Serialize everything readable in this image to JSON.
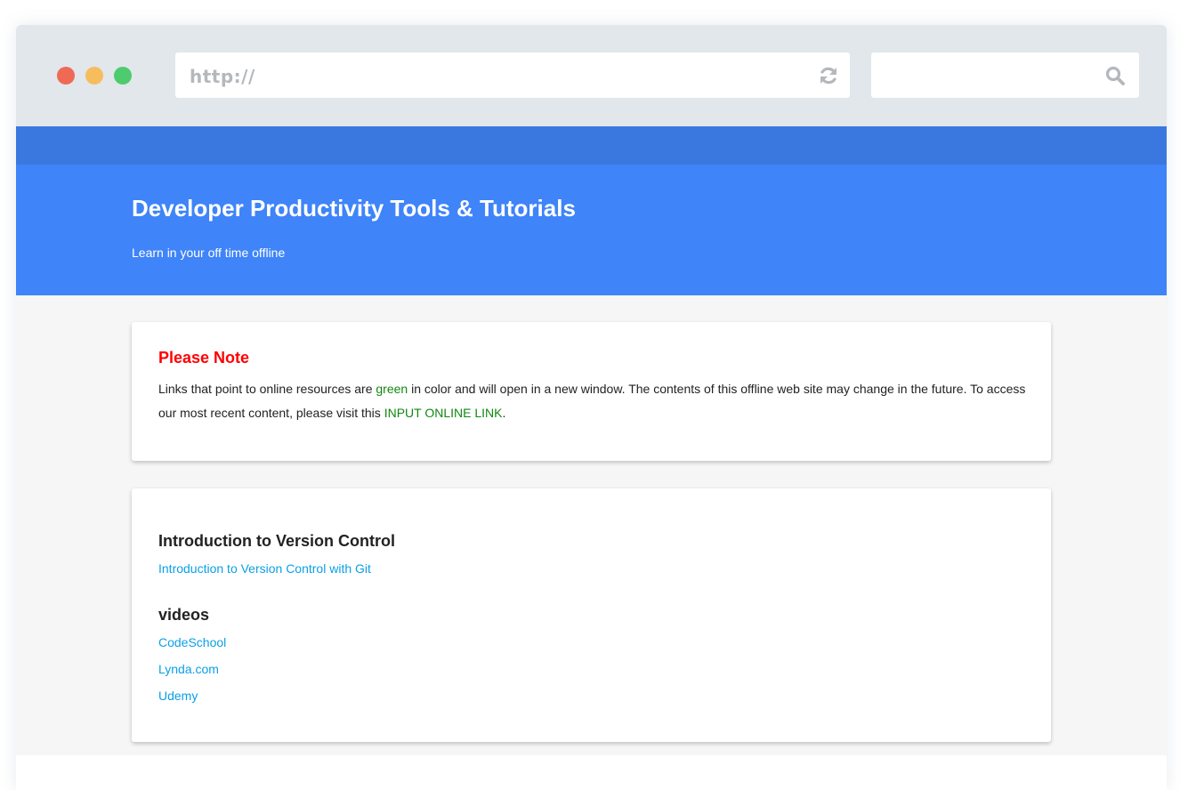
{
  "browser": {
    "window_controls": [
      {
        "name": "close",
        "color": "#ee6a54"
      },
      {
        "name": "minimize",
        "color": "#f6bd5d"
      },
      {
        "name": "maximize",
        "color": "#4fcb6f"
      }
    ],
    "url_bar": {
      "value": "http://",
      "icon": "refresh-icon"
    },
    "search_bar": {
      "value": "",
      "icon": "search-icon"
    }
  },
  "hero": {
    "title": "Developer Productivity Tools & Tutorials",
    "subtitle": "Learn in your off time offline"
  },
  "note": {
    "title": "Please Note",
    "text_1": "Links that point to online resources are ",
    "green_word": "green",
    "text_2": " in color and will open in a new window. The contents of this offline web site may change in the future. To access our most recent content, please visit this ",
    "link_label": "INPUT ONLINE LINK",
    "text_3": "."
  },
  "sections": [
    {
      "heading": "Introduction to Version Control",
      "links": [
        "Introduction to Version Control with Git"
      ]
    },
    {
      "heading": "videos",
      "links": [
        "CodeSchool",
        "Lynda.com",
        "Udemy"
      ]
    }
  ],
  "colors": {
    "chrome": "#e1e7eb",
    "nav_strip": "#3a78e0",
    "hero": "#3f84f8",
    "note_title": "#ff0000",
    "online_link": "#118811",
    "link": "#0aa0e6"
  }
}
